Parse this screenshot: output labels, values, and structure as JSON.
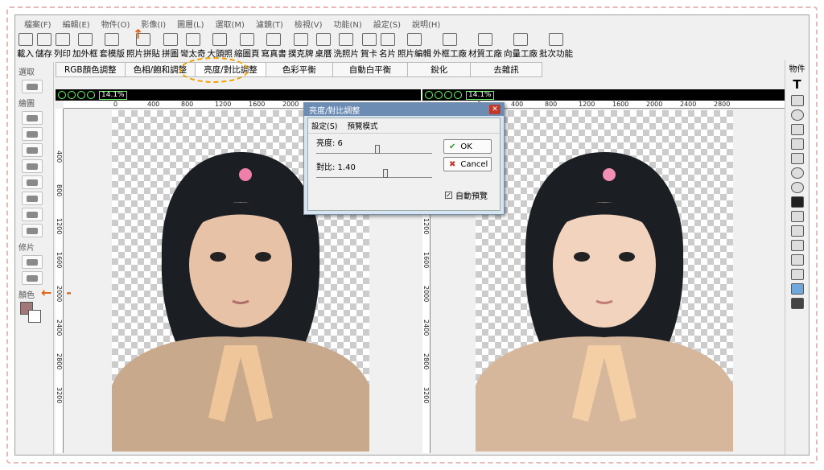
{
  "menus": [
    "檔案(F)",
    "編輯(E)",
    "物件(O)",
    "影像(I)",
    "圖層(L)",
    "選取(M)",
    "濾鏡(T)",
    "檢視(V)",
    "功能(N)",
    "設定(S)",
    "說明(H)"
  ],
  "toolbar": [
    "載入",
    "儲存",
    "列印",
    "加外框",
    "套模版",
    "照片拼貼",
    "拼圖",
    "彎太奇",
    "大頭照",
    "縮圖頁",
    "寫真書",
    "撲克牌",
    "桌曆",
    "洗照片",
    "賀卡",
    "名片",
    "照片編輯",
    "外框工廠",
    "材質工廠",
    "向量工廠",
    "批次功能"
  ],
  "tabs": [
    "RGB顏色調整",
    "色相/飽和調整",
    "亮度/對比調整",
    "色彩平衡",
    "自動白平衡",
    "銳化",
    "去雜訊"
  ],
  "left_panel": {
    "select_label": "選取",
    "draw_label": "繪圖",
    "retouch_label": "修片",
    "color_label": "顏色"
  },
  "right_panel": {
    "title": "物件"
  },
  "zoom_left": "14.1%",
  "zoom_right": "14.1%",
  "ruler_ticks_left": [
    "0",
    "400",
    "800",
    "1200",
    "1600",
    "2000"
  ],
  "ruler_ticks_right": [
    "0",
    "400",
    "800",
    "1200",
    "1600",
    "2000",
    "2400",
    "2800"
  ],
  "vruler_ticks": [
    "400",
    "800",
    "1200",
    "1600",
    "2000",
    "2400",
    "2800",
    "3200"
  ],
  "dialog": {
    "title": "亮度/對比調整",
    "menu": [
      "設定(S)",
      "預覽模式"
    ],
    "brightness_label": "亮度: 6",
    "contrast_label": "對比: 1.40",
    "brightness_value": 0.53,
    "contrast_value": 0.6,
    "ok": "OK",
    "cancel": "Cancel",
    "auto_preview": "自動預覽"
  }
}
